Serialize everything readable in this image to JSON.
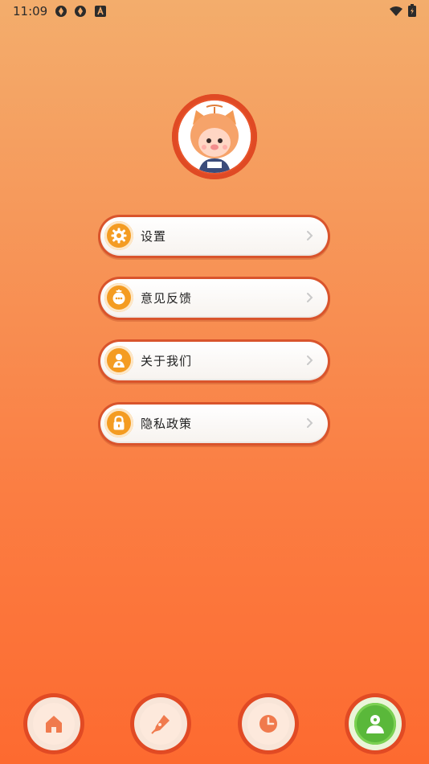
{
  "status_bar": {
    "time": "11:09",
    "left_icons": [
      "app-notification-icon",
      "app-notification-icon",
      "a-badge-icon"
    ],
    "right_icons": [
      "wifi-icon",
      "battery-icon"
    ]
  },
  "profile": {
    "avatar_icon": "avatar-icon"
  },
  "menu": {
    "items": [
      {
        "label": "设置",
        "icon": "gear-icon"
      },
      {
        "label": "意见反馈",
        "icon": "feedback-icon"
      },
      {
        "label": "关于我们",
        "icon": "person-icon"
      },
      {
        "label": "隐私政策",
        "icon": "lock-icon"
      }
    ]
  },
  "bottom_nav": {
    "items": [
      {
        "icon": "home-icon",
        "active": false
      },
      {
        "icon": "pen-icon",
        "active": false
      },
      {
        "icon": "clock-icon",
        "active": false
      },
      {
        "icon": "profile-icon",
        "active": true
      }
    ]
  },
  "colors": {
    "accent": "#f49c22",
    "ring": "#e14a24",
    "active_green": "#5ab83a"
  }
}
